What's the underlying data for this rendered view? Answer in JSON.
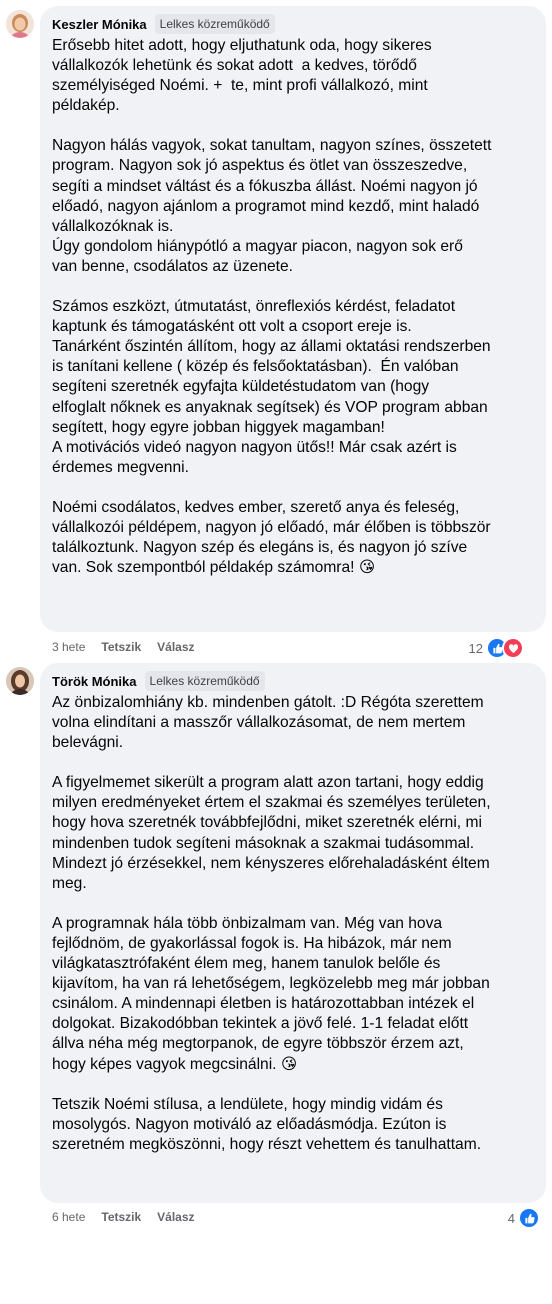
{
  "comments": [
    {
      "author": "Keszler Mónika",
      "badge": "Lelkes közreműködő",
      "paragraphs": [
        "Erősebb hitet adott, hogy eljuthatunk oda, hogy sikeres\nvállalkozók lehetünk és sokat adott  a kedves, törődő\nszemélyiséged Noémi. +  te, mint profi vállalkozó, mint\npéldakép.",
        "Nagyon hálás vagyok, sokat tanultam, nagyon színes, összetett\nprogram. Nagyon sok jó aspektus és ötlet van összeszedve,\nsegíti a mindset váltást és a fókuszba állást. Noémi nagyon jó\nelőadó, nagyon ajánlom a programot mind kezdő, mint haladó\nvállalkozóknak is.\nÚgy gondolom hiánypótló a magyar piacon, nagyon sok erő\nvan benne, csodálatos az üzenete.",
        "Számos eszközt, útmutatást, önreflexiós kérdést, feladatot\nkaptunk és támogatásként ott volt a csoport ereje is.\nTanárként őszintén állítom, hogy az állami oktatási rendszerben\nis tanítani kellene ( közép és felsőoktatásban).  Én valóban\nsegíteni szeretnék egyfajta küldetéstudatom van (hogy\nelfoglalt nőknek es anyaknak segítsek) és VOP program abban\nsegített, hogy egyre jobban higgyek magamban!\nA motivációs videó nagyon nagyon ütős!! Már csak azért is\nérdemes megvenni.",
        "Noémi csodálatos, kedves ember, szerető anya és feleség,\nvállalkozói példépem, nagyon jó előadó, már élőben is többször\ntalálkoztunk. Nagyon szép és elegáns is, és nagyon jó szíve\nvan. Sok szempontból példakép számomra! 😘"
      ],
      "time": "3 hete",
      "like_label": "Tetszik",
      "reply_label": "Válasz",
      "reaction_count": "12"
    },
    {
      "author": "Török Mónika",
      "badge": "Lelkes közreműködő",
      "paragraphs": [
        "Az önbizalomhiány kb. mindenben gátolt. :D Régóta szerettem\nvolna elindítani a masszőr vállalkozásomat, de nem mertem\nbelevágni.",
        "A figyelmemet sikerült a program alatt azon tartani, hogy eddig\nmilyen eredményeket értem el szakmai és személyes területen,\nhogy hova szeretnék továbbfejlődni, miket szeretnék elérni, mi\nmindenben tudok segíteni másoknak a szakmai tudásommal.\nMindezt jó érzésekkel, nem kényszeres előrehaladásként éltem\nmeg.",
        "A programnak hála több önbizalmam van. Még van hova\nfejlődnöm, de gyakorlással fogok is. Ha hibázok, már nem\nvilágkatasztrófaként élem meg, hanem tanulok belőle és\nkijavítom, ha van rá lehetőségem, legközelebb meg már jobban\ncsinálom. A mindennapi életben is határozottabban intézek el\ndolgokat. Bizakodóbban tekintek a jövő felé. 1-1 feladat előtt\nállva néha még megtorpanok, de egyre többször érzem azt,\nhogy képes vagyok megcsinálni. 😘",
        "Tetszik Noémi stílusa, a lendülete, hogy mindig vidám és\nmosolygós. Nagyon motiváló az előadásmódja. Ezúton is\nszeretném megköszönni, hogy részt vehettem és tanulhattam."
      ],
      "time": "6 hete",
      "like_label": "Tetszik",
      "reply_label": "Válasz",
      "reaction_count": "4"
    }
  ],
  "colors": {
    "bubble": "#f0f2f5",
    "like": "#1877f2",
    "love": "#f33e58",
    "meta": "#65676b"
  }
}
